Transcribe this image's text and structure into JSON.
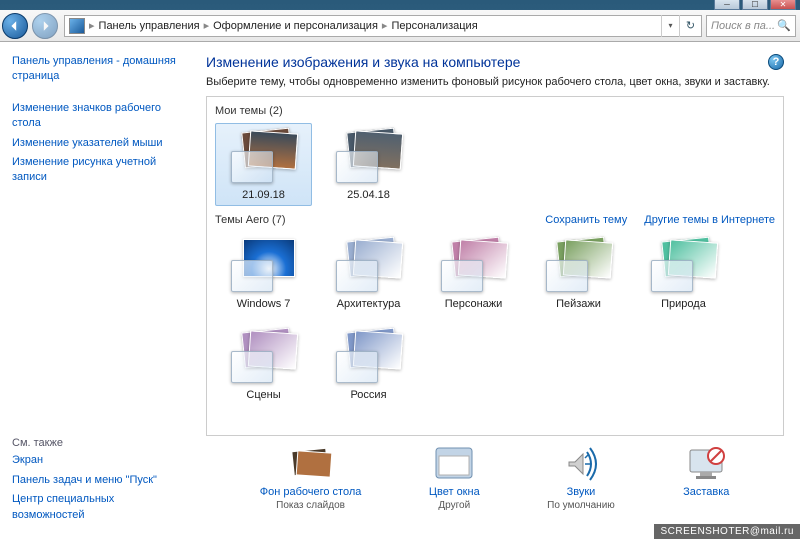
{
  "window": {
    "min_tip": "Свернуть",
    "max_tip": "Развернуть",
    "close_tip": "Закрыть"
  },
  "nav": {
    "back_tip": "Назад",
    "fwd_tip": "Вперед",
    "crumbs": [
      "Панель управления",
      "Оформление и персонализация",
      "Персонализация"
    ],
    "search_placeholder": "Поиск в па...",
    "refresh_tip": "Обновить"
  },
  "sidebar": {
    "links": [
      "Панель управления - домашняя страница",
      "Изменение значков рабочего стола",
      "Изменение указателей мыши",
      "Изменение рисунка учетной записи"
    ],
    "see_also_hdr": "См. также",
    "see_also": [
      "Экран",
      "Панель задач и меню \"Пуск\"",
      "Центр специальных возможностей"
    ]
  },
  "page": {
    "title": "Изменение изображения и звука на компьютере",
    "subtitle": "Выберите тему, чтобы одновременно изменить фоновый рисунок рабочего стола, цвет окна, звуки и заставку.",
    "help_tip": "Справка"
  },
  "sections": {
    "my": {
      "label": "Мои темы (2)",
      "count": 2,
      "themes": [
        "21.09.18",
        "25.04.18"
      ]
    },
    "aero": {
      "label": "Темы Aero (7)",
      "count": 7,
      "save_link": "Сохранить тему",
      "more_link": "Другие темы в Интернете",
      "themes": [
        "Windows 7",
        "Архитектура",
        "Персонажи",
        "Пейзажи",
        "Природа",
        "Сцены",
        "Россия"
      ]
    }
  },
  "bottom": {
    "items": [
      {
        "title": "Фон рабочего стола",
        "sub": "Показ слайдов"
      },
      {
        "title": "Цвет окна",
        "sub": "Другой"
      },
      {
        "title": "Звуки",
        "sub": "По умолчанию"
      },
      {
        "title": "Заставка",
        "sub": ""
      }
    ]
  },
  "watermark": "SCREENSHOTER@mail.ru",
  "colors": {
    "win7": "#1a6fd4",
    "arch": "#9aaed0",
    "pers": "#c080a8",
    "land": "#7aa060",
    "nat": "#50c0a0",
    "scen": "#b090c0",
    "rus": "#8098c8",
    "my1": "#b08860",
    "my2": "#708090"
  }
}
